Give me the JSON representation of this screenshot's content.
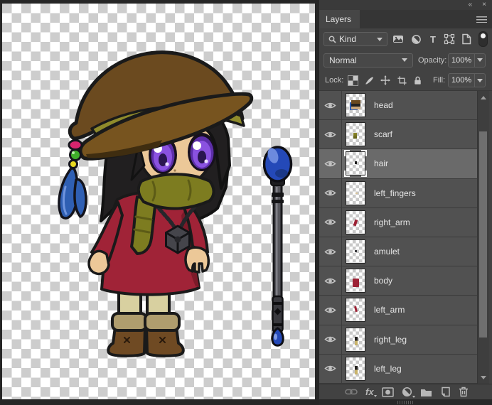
{
  "window": {
    "collapse_glyph": "«",
    "close_glyph": "×"
  },
  "layers_panel": {
    "tab_label": "Layers",
    "panel_menu_icon": "hamburger-menu",
    "filter_bar": {
      "kind_label": "Kind",
      "search_icon": "magnifier",
      "filter_type_icons": [
        "pixel-layers-filter",
        "adjustment-layers-filter",
        "type-layers-filter",
        "shape-layers-filter",
        "smart-objects-filter"
      ],
      "filter_toggle_state": "off"
    },
    "blend_bar": {
      "blend_mode": "Normal",
      "opacity_label": "Opacity:",
      "opacity_value": "100%"
    },
    "lock_bar": {
      "label": "Lock:",
      "lock_icons": [
        "lock-transparent-pixels",
        "lock-image-pixels",
        "lock-position",
        "lock-artboard-nesting",
        "lock-all"
      ],
      "fill_label": "Fill:",
      "fill_value": "100%"
    },
    "layer_list": {
      "selected_layer": "hair",
      "rows": [
        {
          "name": "head"
        },
        {
          "name": "scarf"
        },
        {
          "name": "hair"
        },
        {
          "name": "left_fingers"
        },
        {
          "name": "right_arm"
        },
        {
          "name": "amulet"
        },
        {
          "name": "body"
        },
        {
          "name": "left_arm"
        },
        {
          "name": "right_leg"
        },
        {
          "name": "left_leg"
        }
      ]
    },
    "footer": {
      "fx_label": "fx",
      "icons": [
        "link-layers",
        "layer-style",
        "add-layer-mask",
        "new-adjustment-layer",
        "new-group",
        "new-layer",
        "delete-layer"
      ]
    }
  },
  "artwork": {
    "hat_brown": "#6b4a1f",
    "hat_band_olive": "#8f8b2b",
    "brim_brown": "#77541f",
    "hair_black": "#211f20",
    "skin": "#ecc898",
    "eye_purple": "#8a52e0",
    "scarf_olive": "#7d7c20",
    "dress_red": "#a02337",
    "legging_cream": "#d8d0a0",
    "boot_brown": "#6f4a23",
    "boot_cuff_tan": "#af9d6e",
    "feather_blue": "#2f5fb3",
    "staff_orb_blue": "#2449b8",
    "staff_gray": "#56565c",
    "bead_pink": "#d6246e",
    "bead_green": "#3fae2a",
    "bead_yellow": "#e8d820"
  }
}
